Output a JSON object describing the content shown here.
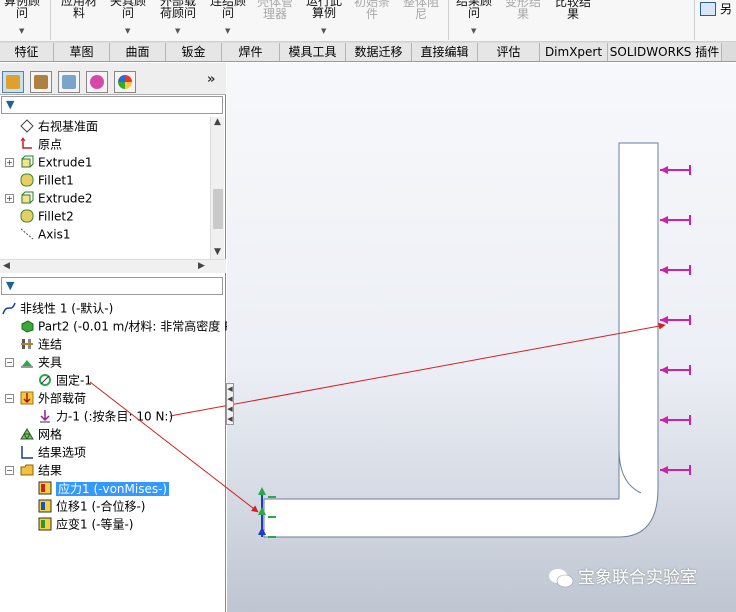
{
  "ribbon": {
    "buttons": [
      {
        "label": "算例顾\n问",
        "disabled": false,
        "dropdown": true
      },
      {
        "label": "应用材\n料",
        "disabled": false,
        "dropdown": false
      },
      {
        "label": "夹具顾\n问",
        "disabled": false,
        "dropdown": true
      },
      {
        "label": "外部载\n荷顾问",
        "disabled": false,
        "dropdown": true
      },
      {
        "label": "连结顾\n问",
        "disabled": false,
        "dropdown": true
      },
      {
        "label": "壳体管\n理器",
        "disabled": true,
        "dropdown": false
      },
      {
        "label": "运行此\n算例",
        "disabled": false,
        "dropdown": true
      },
      {
        "label": "初始条\n件",
        "disabled": true,
        "dropdown": false
      },
      {
        "label": "整体阻\n尼",
        "disabled": true,
        "dropdown": false
      },
      {
        "label": "结果顾\n问",
        "disabled": false,
        "dropdown": true
      },
      {
        "label": "变形结\n果",
        "disabled": true,
        "dropdown": false
      },
      {
        "label": "比较结\n果",
        "disabled": false,
        "dropdown": false
      }
    ],
    "cut_label": "另"
  },
  "tabs": [
    "特征",
    "草图",
    "曲面",
    "钣金",
    "焊件",
    "模具工具",
    "数据迁移",
    "直接编辑",
    "评估",
    "DimXpert",
    "SOLIDWORKS 插件"
  ],
  "feature_tree": {
    "items": [
      {
        "label": "右视基准面",
        "icon": "plane-icon",
        "expand": false
      },
      {
        "label": "原点",
        "icon": "origin-icon",
        "expand": false
      },
      {
        "label": "Extrude1",
        "icon": "extrude-icon",
        "expand": true
      },
      {
        "label": "Fillet1",
        "icon": "fillet-icon",
        "expand": false
      },
      {
        "label": "Extrude2",
        "icon": "extrude-icon",
        "expand": true
      },
      {
        "label": "Fillet2",
        "icon": "fillet-icon",
        "expand": false
      },
      {
        "label": "Axis1",
        "icon": "axis-icon",
        "expand": false
      }
    ]
  },
  "study_tree": {
    "root": "非线性 1 (-默认-)",
    "part": "Part2 (-0.01 m/材料: 非常高密度 P",
    "connections": "连结",
    "fixtures": "夹具",
    "fixture_item": "固定-1",
    "loads": "外部载荷",
    "load_item": "力-1 (:按条目: 10 N:)",
    "mesh": "网格",
    "result_options": "结果选项",
    "results": "结果",
    "result_items": [
      "应力1 (-vonMises-)",
      "位移1 (-合位移-)",
      "应变1 (-等量-)"
    ]
  },
  "panel_more": "»",
  "watermark": "宝象联合实验室",
  "colors": {
    "force_arrow": "#cc22aa",
    "callout_line": "#d42020",
    "selection": "#3399ff",
    "fixture_green": "#2aa84a",
    "axis_blue": "#1a3fbf"
  }
}
